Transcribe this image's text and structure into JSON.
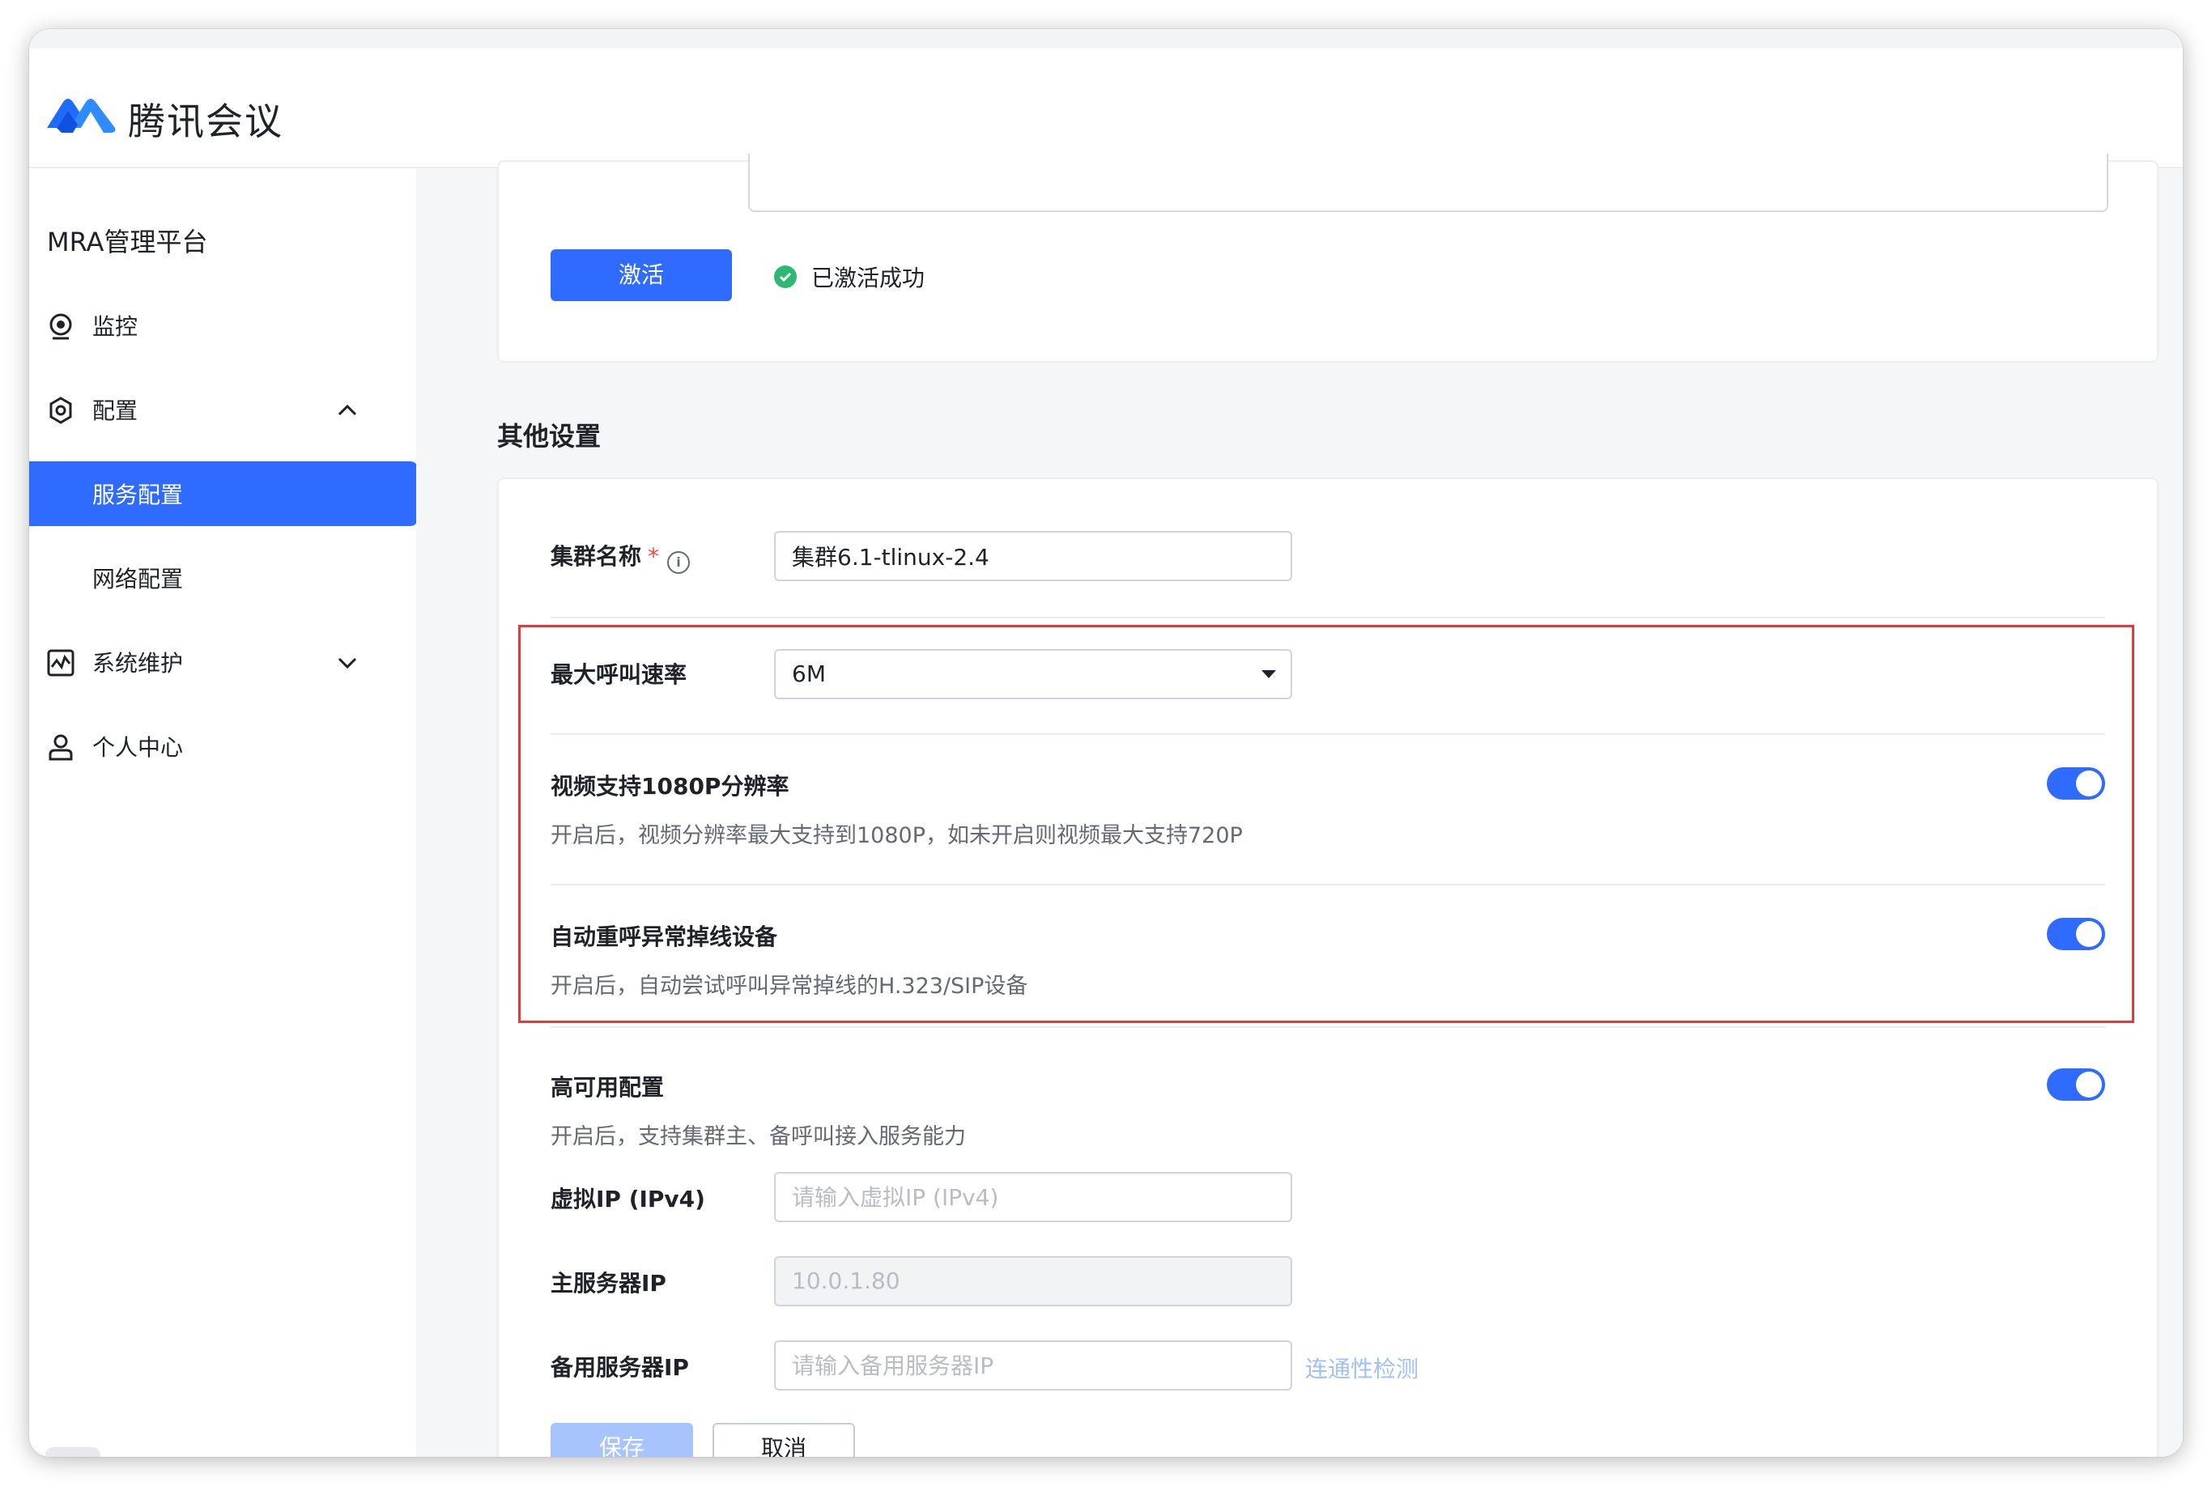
{
  "app": {
    "name": "腾讯会议"
  },
  "sidebar": {
    "title": "MRA管理平台",
    "items": [
      {
        "label": "监控",
        "icon": "monitor-camera-icon"
      },
      {
        "label": "配置",
        "icon": "gear-icon",
        "expanded": true
      },
      {
        "label": "服务配置",
        "active": true
      },
      {
        "label": "网络配置"
      },
      {
        "label": "系统维护",
        "icon": "activity-chart-icon",
        "expanded": false
      },
      {
        "label": "个人中心",
        "icon": "user-icon"
      }
    ]
  },
  "activation": {
    "button": "激活",
    "status": "已激活成功"
  },
  "other": {
    "section_title": "其他设置",
    "cluster_name": {
      "label": "集群名称",
      "required_mark": "*",
      "info_icon": "i",
      "value": "集群6.1-tlinux-2.4"
    },
    "max_call_rate": {
      "label": "最大呼叫速率",
      "value": "6M"
    },
    "video_1080p": {
      "label": "视频支持1080P分辨率",
      "desc": "开启后，视频分辨率最大支持到1080P，如未开启则视频最大支持720P",
      "enabled": true
    },
    "auto_redial": {
      "label": "自动重呼异常掉线设备",
      "desc": "开启后，自动尝试呼叫异常掉线的H.323/SIP设备",
      "enabled": true
    },
    "high_availability": {
      "label": "高可用配置",
      "desc": "开启后，支持集群主、备呼叫接入服务能力",
      "enabled": true
    },
    "virtual_ip": {
      "label": "虚拟IP (IPv4)",
      "placeholder": "请输入虚拟IP (IPv4)"
    },
    "primary_ip": {
      "label": "主服务器IP",
      "value": "10.0.1.80"
    },
    "backup_ip": {
      "label": "备用服务器IP",
      "placeholder": "请输入备用服务器IP",
      "link": "连通性检测"
    }
  },
  "actions": {
    "save": "保存",
    "cancel": "取消"
  },
  "colors": {
    "primary": "#2f6bff",
    "success": "#2eb872",
    "highlight": "#e03b3b"
  }
}
